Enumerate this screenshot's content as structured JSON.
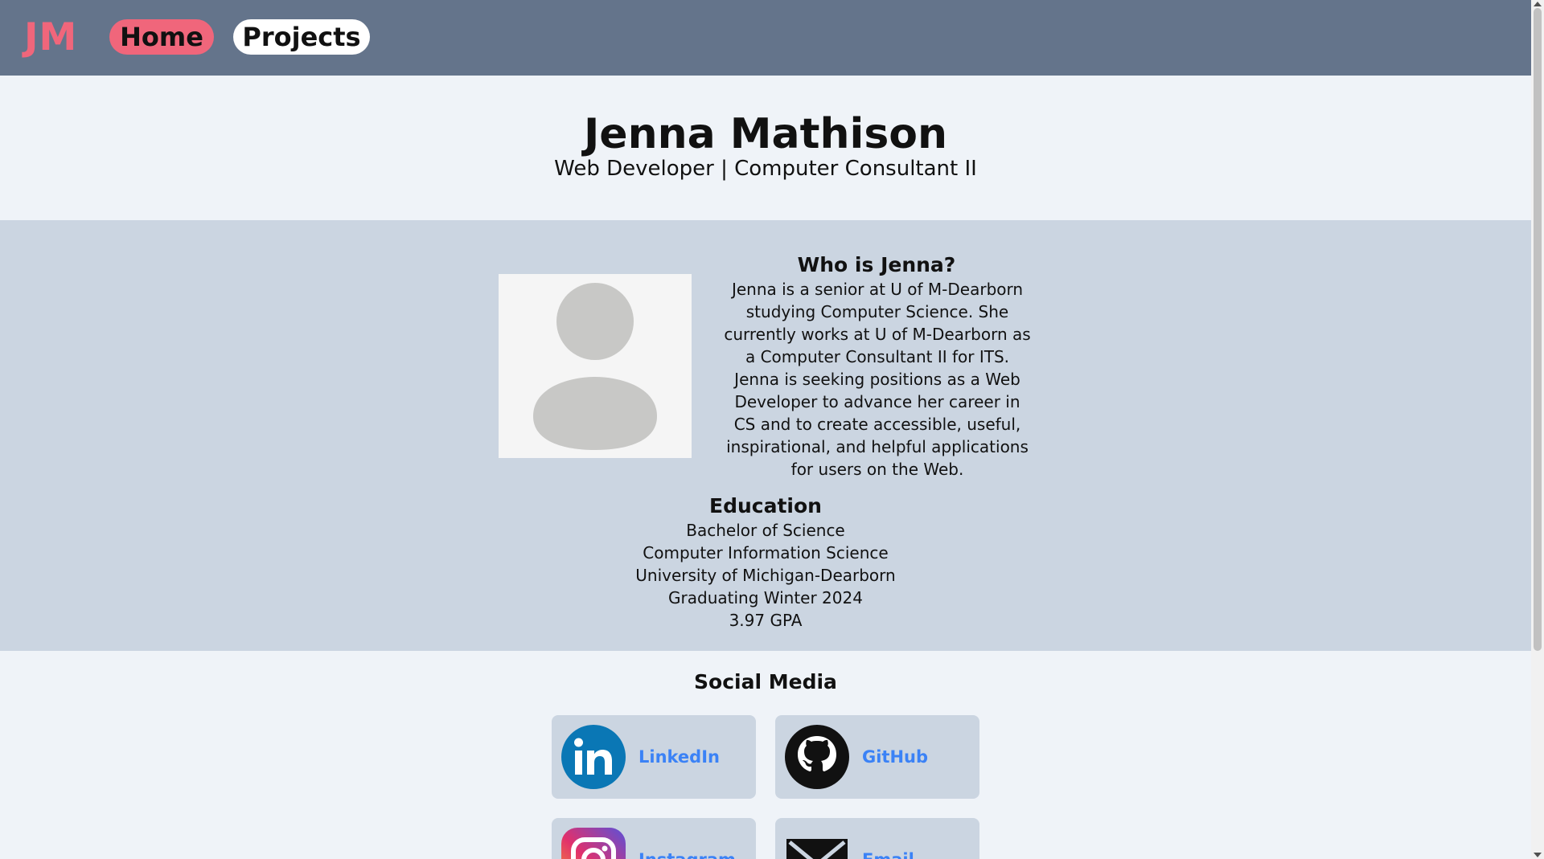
{
  "nav": {
    "logo": "JM",
    "home_label": "Home",
    "projects_label": "Projects"
  },
  "hero": {
    "name": "Jenna Mathison",
    "subtitle": "Web Developer | Computer Consultant II"
  },
  "about": {
    "title": "Who is Jenna?",
    "text": "Jenna is a senior at U of M-Dearborn studying Computer Science. She currently works at U of M-Dearborn as a Computer Consultant II for ITS. Jenna is seeking positions as a Web Developer to advance her career in CS and to create accessible, useful, inspirational, and helpful applications for users on the Web."
  },
  "education": {
    "title": "Education",
    "lines": [
      "Bachelor of Science",
      "Computer Information Science",
      "University of Michigan-Dearborn",
      "Graduating Winter 2024",
      "3.97 GPA"
    ]
  },
  "social": {
    "title": "Social Media",
    "items": [
      {
        "label": "LinkedIn",
        "icon": "linkedin-icon"
      },
      {
        "label": "GitHub",
        "icon": "github-icon"
      },
      {
        "label": "Instagram",
        "icon": "instagram-icon"
      },
      {
        "label": "Email",
        "icon": "email-icon"
      }
    ]
  },
  "colors": {
    "navbar": "#64748b",
    "accent_pink": "#f0667b",
    "band": "#cbd5e1",
    "background": "#eff3f8",
    "link_blue": "#3b82f6",
    "linkedin_blue": "#0a77b5"
  }
}
